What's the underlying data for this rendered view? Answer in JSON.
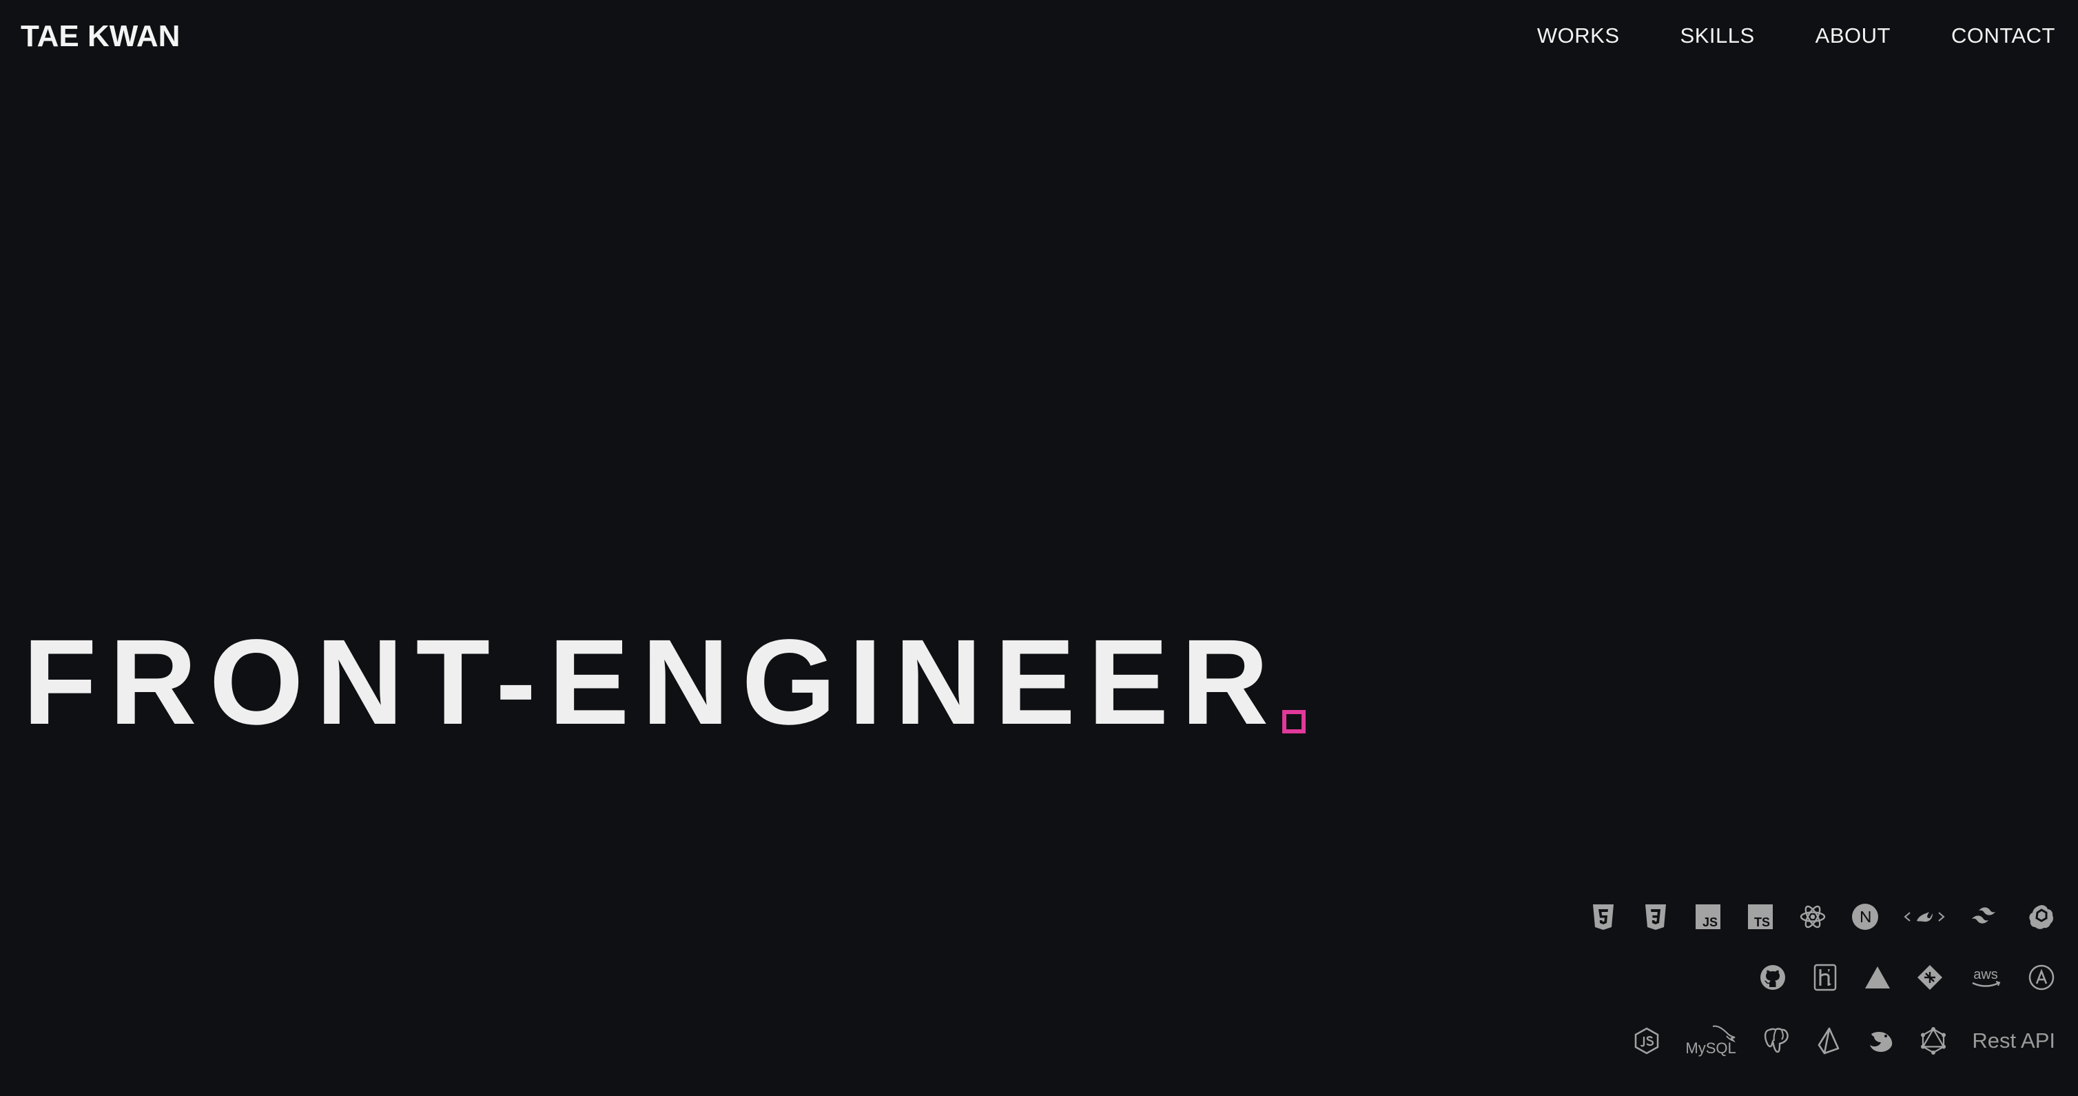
{
  "header": {
    "brand": "TAE KWAN",
    "nav": [
      {
        "label": "WORKS"
      },
      {
        "label": "SKILLS"
      },
      {
        "label": "ABOUT"
      },
      {
        "label": "CONTACT"
      }
    ]
  },
  "hero": {
    "title": "FRONT-ENGINEER",
    "accent": "#e0399a"
  },
  "tech_stack": {
    "row1": [
      "html5-icon",
      "css3-icon",
      "javascript-icon",
      "typescript-icon",
      "react-icon",
      "nextjs-icon",
      "styled-components-icon",
      "tailwind-icon",
      "openai-icon"
    ],
    "row2": [
      "github-icon",
      "heroku-icon",
      "vercel-icon",
      "netlify-icon",
      "aws-icon",
      "appstore-icon"
    ],
    "row3": [
      "nodejs-icon",
      "mysql-icon",
      "postgresql-icon",
      "prisma-icon",
      "nestjs-icon",
      "graphql-icon"
    ],
    "rest_label": "Rest API",
    "mysql_label": "MySQL",
    "ts_label": "TS",
    "js_label": "JS",
    "aws_label": "aws",
    "icon_color": "#a3a3a3"
  }
}
